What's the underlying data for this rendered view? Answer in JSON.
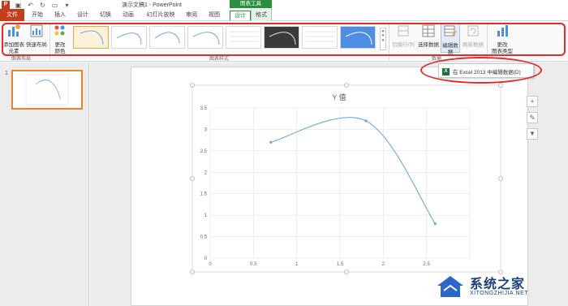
{
  "app": {
    "title": "演示文稿1 - PowerPoint",
    "contextual_group": "图表工具",
    "brand_color": "#c43e1c",
    "context_color": "#2a8f3e",
    "highlight_color": "#e22b2b"
  },
  "tabs": [
    {
      "label": "文件"
    },
    {
      "label": "开始"
    },
    {
      "label": "插入"
    },
    {
      "label": "设计"
    },
    {
      "label": "切换"
    },
    {
      "label": "动画"
    },
    {
      "label": "幻灯片放映"
    },
    {
      "label": "审阅"
    },
    {
      "label": "视图"
    },
    {
      "label": "设计"
    },
    {
      "label": "格式"
    }
  ],
  "ribbon": {
    "add_element": "添加图表\n元素",
    "quick_layout": "快速布局",
    "change_color": "更改\n颜色",
    "switch_row_col": "切换行/列",
    "select_data": "选择数据",
    "edit_data": "编辑数\n据",
    "refresh_data": "刷新数据",
    "change_type": "更改\n图表类型",
    "group_layouts": "图表布局",
    "group_styles": "图表样式",
    "group_data": "数据",
    "style_count": 8
  },
  "dropdown": {
    "item_label": "在 Excel 2013 中编辑数据(D)"
  },
  "slides": {
    "current_number": "1"
  },
  "chart_data": {
    "type": "scatter",
    "title": "Y 值",
    "smooth": true,
    "x": [
      0.7,
      1.8,
      2.6
    ],
    "y": [
      2.7,
      3.2,
      0.8
    ],
    "xlim": [
      0,
      3
    ],
    "ylim": [
      0,
      3.5
    ],
    "x_ticks": [
      "0",
      "0.5",
      "1",
      "1.5",
      "2",
      "2.5"
    ],
    "y_ticks": [
      "0",
      "0.5",
      "1",
      "1.5",
      "2",
      "2.5",
      "3",
      "3.5"
    ],
    "grid": true,
    "series_color": "#6fa8dc"
  },
  "watermark": {
    "cn": "系统之家",
    "en": "XITONGZHIJIA.NET"
  }
}
